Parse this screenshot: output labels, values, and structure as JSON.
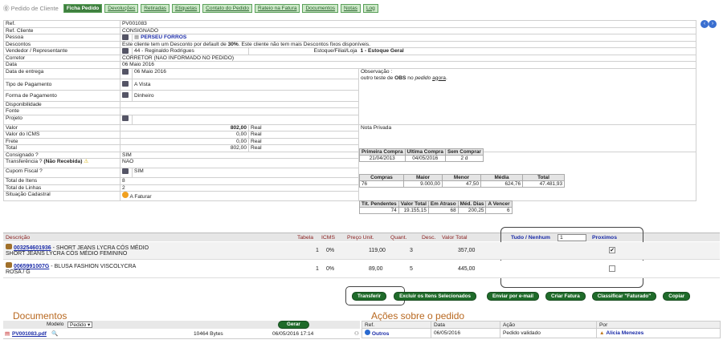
{
  "app_title": "Pedido de Cliente",
  "tabs": [
    "Ficha Pedido",
    "Devoluções",
    "Retiradas",
    "Etiquetas",
    "Contato do Pedido",
    "Rateio na Fatura",
    "Documentos",
    "Notas",
    "Log"
  ],
  "fields": {
    "ref_label": "Ref.",
    "ref": "PV001083",
    "ref_cliente_label": "Ref. Cliente",
    "ref_cliente": "CONSIGNADO",
    "pessoa_label": "Pessoa",
    "pessoa": "PERSEU FORROS",
    "descontos_label": "Descontos",
    "descontos_pre": "Este cliente tem um Desconto por default de ",
    "descontos_pct": "30%",
    "descontos_post": ". Este cliente não tem mais Descontos fixos disponíveis.",
    "vendedor_label": "Vendedor / Representante",
    "vendedor": "44 - Reginaldo Rodrigues",
    "estoque_label": "Estoque/Filial/Loja",
    "estoque": "1 - Estoque Geral",
    "corretor_label": "Corretor",
    "corretor": "CORRETOR (NÃO INFORMADO NO PEDIDO)",
    "data_label": "Data",
    "data": "06 Maio 2016",
    "entrega_label": "Data de entrega",
    "entrega": "06 Maio 2016",
    "tipo_pag_label": "Tipo de Pagamento",
    "tipo_pag": "A Vista",
    "forma_pag_label": "Forma de Pagamento",
    "forma_pag": "Dinheiro",
    "disponibilidade_label": "Disponibilidade",
    "fonte_label": "Fonte",
    "projeto_label": "Projeto",
    "obs_label": "Observação :",
    "obs_1": "outro teste de ",
    "obs_2": "OBS",
    "obs_3": " no ",
    "obs_4": "pedido",
    "obs_5": " ",
    "obs_6": "agora",
    "obs_7": ".",
    "valor_label": "Valor",
    "valor": "802,00",
    "icms_label": "Valor do ICMS",
    "icms": "0,00",
    "frete_label": "Frete",
    "frete": "0,00",
    "total_label": "Total",
    "total": "802,00",
    "real": "Real",
    "consignado_label": "Consignado ?",
    "consignado": "SIM",
    "transf_label": "Transferência ? ",
    "transf_bold": "(Não Recebida)",
    "transf": "NÃO",
    "cupom_label": "Cupom Fiscal ?",
    "cupom": "SIM",
    "total_itens_label": "Total de Itens",
    "total_itens": "8",
    "total_linhas_label": "Total de Linhas",
    "total_linhas": "2",
    "situacao_label": "Situação Cadastral",
    "situacao": "A Faturar",
    "nota_privada": "Nota Privada"
  },
  "stats1": {
    "headers": [
      "Primeira Compra",
      "Ultima Compra",
      "Sem Comprar"
    ],
    "values": [
      "21/04/2013",
      "04/05/2016",
      "2 d"
    ]
  },
  "stats2": {
    "headers": [
      "Compras",
      "Maior",
      "Menor",
      "Média",
      "Total"
    ],
    "values": [
      "76",
      "9.000,00",
      "47,50",
      "624,76",
      "47.481,93"
    ]
  },
  "stats3": {
    "headers": [
      "Tít. Pendentes",
      "Valor Total",
      "Em Atraso",
      "Méd. Dias",
      "A Vencer"
    ],
    "values": [
      "74",
      "19.155,15",
      "68",
      "200,25",
      "6"
    ]
  },
  "items_header": {
    "descricao": "Descrição",
    "tabela": "Tabela",
    "icms": "ICMS",
    "preco": "Preço Unit.",
    "quant": "Quant.",
    "desc": "Desc.",
    "valor_total": "Valor Total",
    "tudo": "Tudo / Nenhum",
    "qty_input": "1",
    "proximos": "Proximos"
  },
  "items": [
    {
      "code": "003254601936",
      "desc1": " - SHORT JEANS LYCRA CÓS MÉDIO",
      "desc2": "SHORT JEANS LYCRA CÓS  MÉDIO  FEMININO",
      "tabela": "1",
      "icms": "0%",
      "preco": "119,00",
      "quant": "3",
      "valor": "357,00",
      "checked": true
    },
    {
      "code": "0065991007G",
      "desc1": " - BLUSA FASHION VISCOLYCRA",
      "desc2": "ROSA / G",
      "tabela": "1",
      "icms": "0%",
      "preco": "89,00",
      "quant": "5",
      "valor": "445,00",
      "checked": false
    }
  ],
  "buttons": [
    "Transferir",
    "Excluir os Itens Selecionados",
    "Enviar por e-mail",
    "Criar Fatura",
    "Classificar \"Faturado\"",
    "Copiar"
  ],
  "documentos": {
    "title": "Documentos",
    "modelo_label": "Modelo",
    "modelo_value": "Pedido",
    "gerar": "Gerar",
    "file": "PV001083.pdf",
    "size": "10464 Bytes",
    "datetime": "06/05/2016 17:14"
  },
  "acoes": {
    "title": "Ações sobre o pedido",
    "headers": [
      "Ref.",
      "Data",
      "Ação",
      "Por"
    ],
    "row": [
      "Outros",
      "06/05/2016",
      "Pedido validado",
      "Alicia Menezes"
    ]
  },
  "colors": {
    "tab_bg": "#cde9c8",
    "tab_active": "#3e7f3e",
    "button_green": "#1f6b2a",
    "heading_orange": "#b86820",
    "link_blue": "#1a2ba8"
  }
}
